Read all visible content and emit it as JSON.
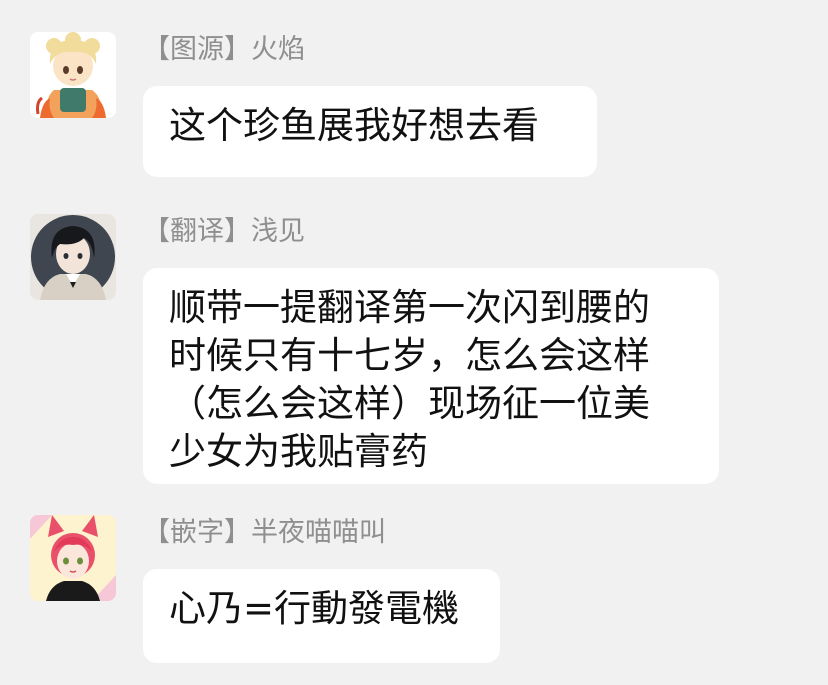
{
  "messages": [
    {
      "avatar": "chibi-boy-avatar",
      "sender": "【图源】火焰",
      "lines": [
        "这个珍鱼展我好想去看"
      ]
    },
    {
      "avatar": "dark-hair-boy-avatar",
      "sender": "【翻译】浅见",
      "lines": [
        "顺带一提翻译第一次闪到腰的",
        "时候只有十七岁，怎么会这样",
        "（怎么会这样）现场征一位美",
        "少女为我贴膏药"
      ]
    },
    {
      "avatar": "cat-ear-girl-avatar",
      "sender": "【嵌字】半夜喵喵叫",
      "lines": [
        "心乃=行動發電機"
      ]
    }
  ],
  "colors": {
    "background": "#f1f1f1",
    "bubble": "#ffffff",
    "sender_text": "#8f8f8f",
    "message_text": "#111111"
  }
}
